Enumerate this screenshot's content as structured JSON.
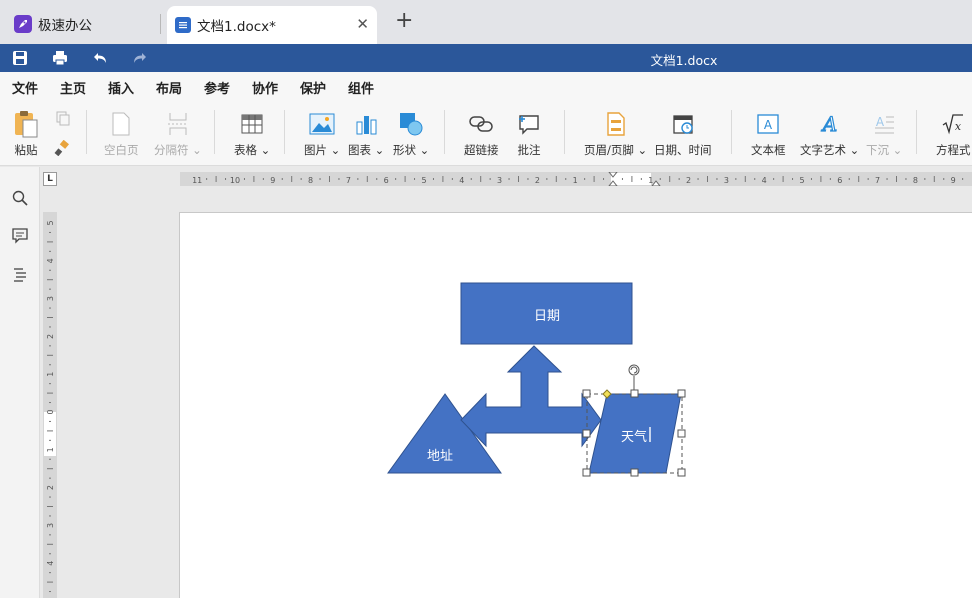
{
  "tabs": {
    "app_title": "极速办公",
    "doc_tab_title": "文档1.docx*",
    "close_glyph": "✕",
    "new_tab_glyph": "+"
  },
  "titlebar": {
    "document_title": "文档1.docx"
  },
  "menu": [
    "文件",
    "主页",
    "插入",
    "布局",
    "参考",
    "协作",
    "保护",
    "组件"
  ],
  "menu_active": "插入",
  "ribbon": {
    "paste": "粘贴",
    "blank_page": "空白页",
    "page_break": "分隔符",
    "table": "表格",
    "image": "图片",
    "chart": "图表",
    "shape": "形状",
    "hyperlink": "超链接",
    "comment": "批注",
    "header_footer": "页眉/页脚",
    "date_time": "日期、时间",
    "text_box": "文本框",
    "word_art": "文字艺术",
    "drop_cap": "下沉",
    "equation": "方程式"
  },
  "ruler_corner": "L",
  "canvas": {
    "rect_label": "日期",
    "triangle_label": "地址",
    "parallelogram_label": "天气"
  },
  "colors": {
    "accent": "#2b579a",
    "shape_fill": "#4472c4",
    "shape_stroke": "#2f528f"
  }
}
